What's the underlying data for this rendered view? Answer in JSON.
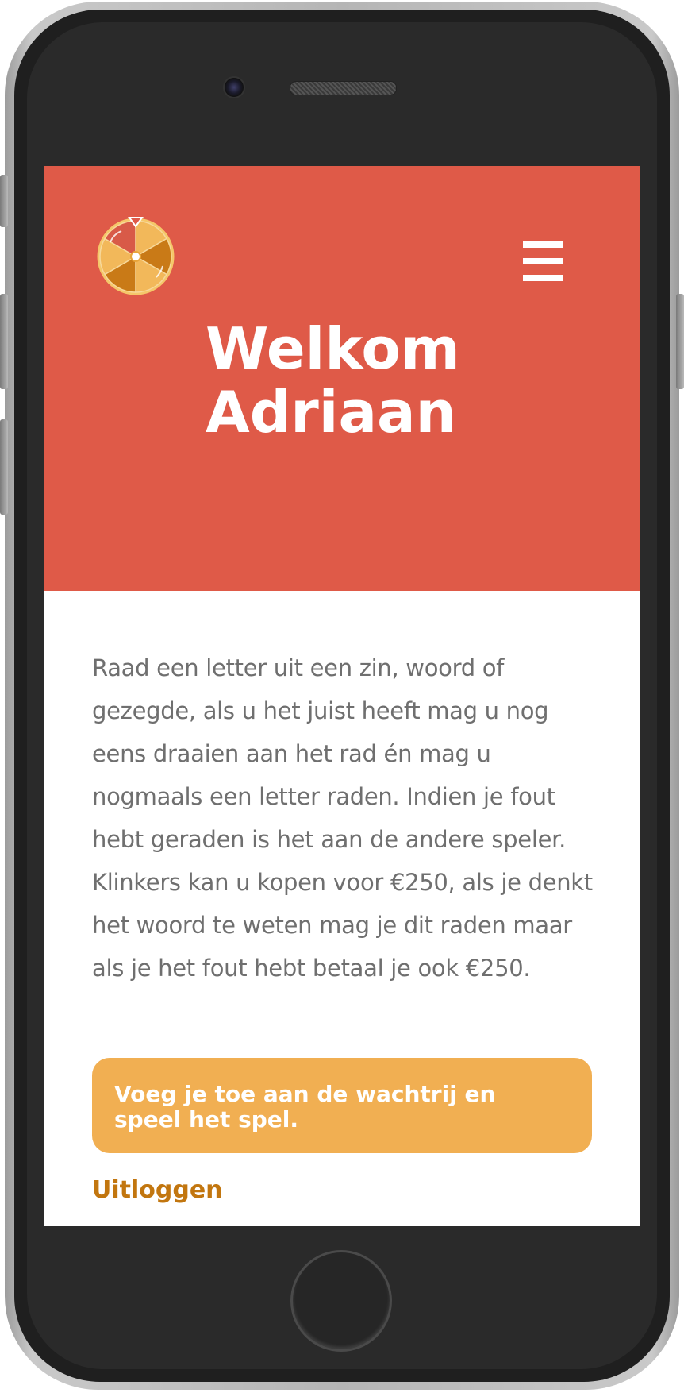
{
  "header": {
    "logo": "prize-wheel-logo",
    "menu_icon": "hamburger-menu-icon",
    "title_line1": "Welkom",
    "title_line2": "Adriaan"
  },
  "main": {
    "intro": "Raad een letter uit een zin, woord of gezegde, als u het juist heeft mag u nog eens draaien aan het rad én mag u nogmaals een letter raden. Indien je fout hebt geraden is het aan de andere speler. Klinkers kan u kopen voor €250, als je denkt het woord te weten mag je dit raden maar als je het fout hebt betaal je ook €250.",
    "cta_label": "Voeg je toe aan de wachtrij en speel het spel.",
    "logout_label": "Uitloggen"
  },
  "colors": {
    "hero_background": "#df5a48",
    "cta_background": "#f1af52",
    "logout_text": "#c2760f",
    "body_text": "#6f6f6f"
  }
}
